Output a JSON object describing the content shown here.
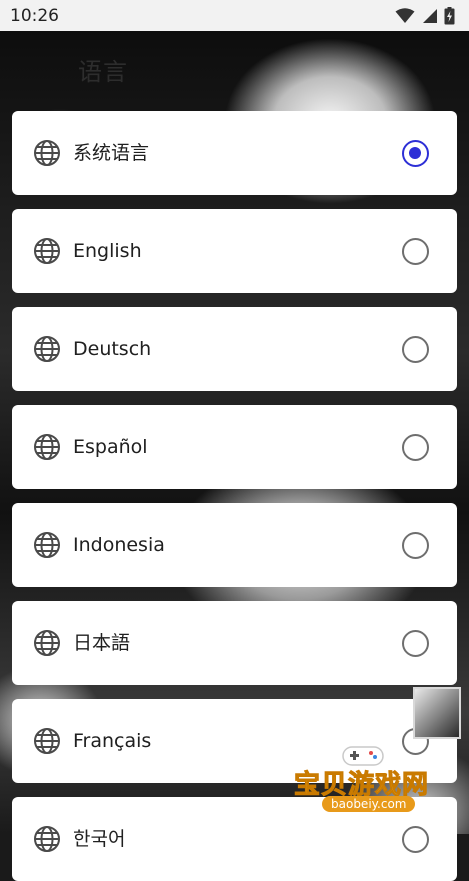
{
  "status_bar": {
    "time": "10:26"
  },
  "header": {
    "title": "语言"
  },
  "languages": [
    {
      "label": "系统语言",
      "selected": true
    },
    {
      "label": "English",
      "selected": false
    },
    {
      "label": "Deutsch",
      "selected": false
    },
    {
      "label": "Español",
      "selected": false
    },
    {
      "label": "Indonesia",
      "selected": false
    },
    {
      "label": "日本語",
      "selected": false
    },
    {
      "label": "Français",
      "selected": false
    },
    {
      "label": "한국어",
      "selected": false
    }
  ],
  "watermark": {
    "title": "宝贝游戏网",
    "url": "baobeiy.com"
  },
  "colors": {
    "accent": "#2d2fd6",
    "card": "#ffffff",
    "radio_off": "#6e6e6e"
  },
  "icons": {
    "item_icon": "globe-icon",
    "selected": "radio-selected-icon",
    "unselected": "radio-unselected-icon"
  }
}
